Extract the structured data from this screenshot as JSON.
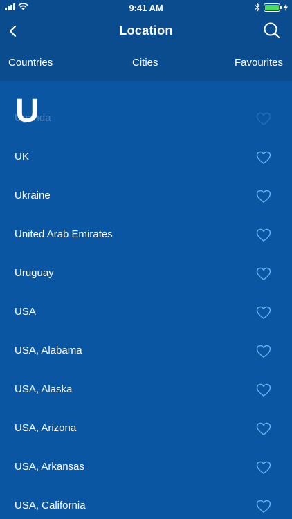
{
  "status_bar": {
    "time": "9:41 AM"
  },
  "nav": {
    "title": "Location"
  },
  "tabs": [
    {
      "label": "Countries",
      "active": true
    },
    {
      "label": "Cities",
      "active": false
    },
    {
      "label": "Favourites",
      "active": false
    }
  ],
  "section": {
    "letter": "U"
  },
  "countries": [
    "Uganda",
    "UK",
    "Ukraine",
    "United Arab Emirates",
    "Uruguay",
    "USA",
    "USA, Alabama",
    "USA, Alaska",
    "USA, Arizona",
    "USA, Arkansas",
    "USA, California"
  ],
  "colors": {
    "header_bg": "#0b4c8e",
    "list_bg": "#0a56a3",
    "active_tab": "#f5c518",
    "heart": "#6fb2ef",
    "battery": "#4cd964"
  }
}
